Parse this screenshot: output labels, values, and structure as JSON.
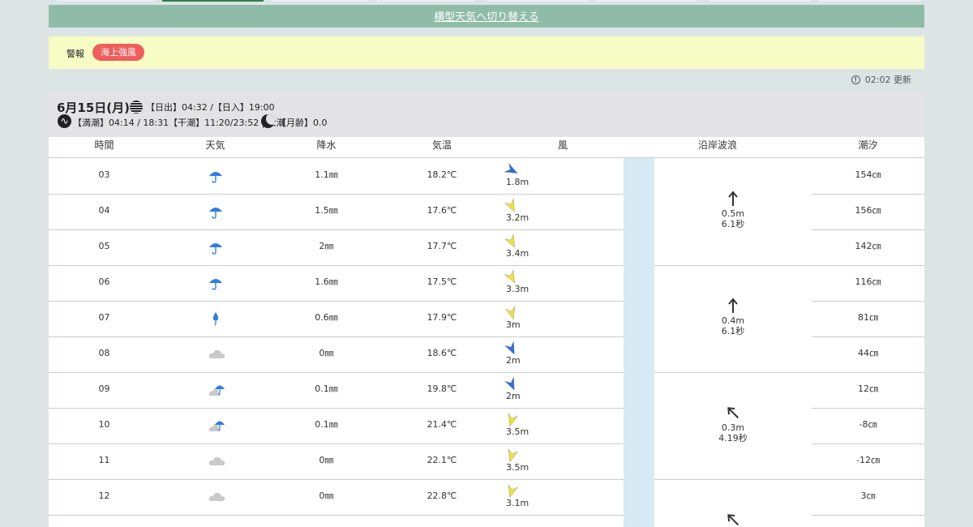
{
  "switch_link": "横型天気へ切り替える",
  "warning": {
    "label": "警報",
    "badge": "海上強風"
  },
  "update": {
    "text": "02:02 更新"
  },
  "day": {
    "date": "6月15日(月)",
    "sun": "【日出】04:32 /【日入】19:00",
    "tide": "【満潮】04:14 / 18:31【干潮】11:20/23:52 | 大潮",
    "moon": "【月齢】0.0"
  },
  "headers": [
    "時間",
    "天気",
    "降水",
    "気温",
    "風",
    "沿岸波浪",
    "潮汐"
  ],
  "rows": [
    {
      "time": "03",
      "weather": "rain",
      "precip": "1.1㎜",
      "temp": "18.2℃",
      "wind": "1.8m",
      "tide": "154㎝"
    },
    {
      "time": "04",
      "weather": "rain",
      "precip": "1.5㎜",
      "temp": "17.6℃",
      "wind": "3.2m",
      "tide": "156㎝"
    },
    {
      "time": "05",
      "weather": "rain",
      "precip": "2㎜",
      "temp": "17.7℃",
      "wind": "3.4m",
      "tide": "142㎝"
    },
    {
      "time": "06",
      "weather": "rain",
      "precip": "1.6㎜",
      "temp": "17.5℃",
      "wind": "3.3m",
      "tide": "116㎝"
    },
    {
      "time": "07",
      "weather": "light-rain",
      "precip": "0.6㎜",
      "temp": "17.9℃",
      "wind": "3m",
      "tide": "81㎝"
    },
    {
      "time": "08",
      "weather": "cloud",
      "precip": "0㎜",
      "temp": "18.6℃",
      "wind": "2m",
      "tide": "44㎝"
    },
    {
      "time": "09",
      "weather": "cloud-rain",
      "precip": "0.1㎜",
      "temp": "19.8℃",
      "wind": "2m",
      "tide": "12㎝"
    },
    {
      "time": "10",
      "weather": "cloud-rain",
      "precip": "0.1㎜",
      "temp": "21.4℃",
      "wind": "3.5m",
      "tide": "-8㎝"
    },
    {
      "time": "11",
      "weather": "cloud",
      "precip": "0㎜",
      "temp": "22.1℃",
      "wind": "3.5m",
      "tide": "-12㎝"
    },
    {
      "time": "12",
      "weather": "cloud",
      "precip": "0㎜",
      "temp": "22.8℃",
      "wind": "3.1m",
      "tide": "3㎝"
    }
  ],
  "waves": [
    {
      "height": "0.5m",
      "period": "6.1秒",
      "direction": "north"
    },
    {
      "height": "0.4m",
      "period": "6.1秒",
      "direction": "north"
    },
    {
      "height": "0.3m",
      "period": "4.19秒",
      "direction": "northwest"
    },
    {
      "height": "",
      "period": "",
      "direction": "northwest"
    }
  ],
  "colors": {
    "rain_icon": "#2f7de1",
    "wind_strong": "#f2e23a",
    "wind_light": "#2f6fd8",
    "warning_badge": "#ef5d5d",
    "switch_bar": "#8fbca8",
    "warning_bar": "#f7fcc4"
  }
}
